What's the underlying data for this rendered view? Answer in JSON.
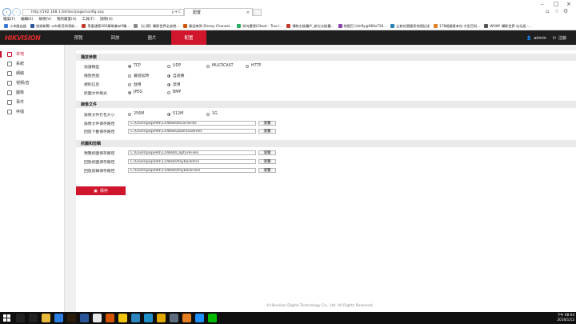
{
  "browser": {
    "url": "http://192.168.1.64/doc/page/config.asp",
    "addr_controls": "ρ ▾ C",
    "tab_title": "配置",
    "menu": [
      "檔案(F)",
      "編輯(E)",
      "檢視(V)",
      "我的最愛(A)",
      "工具(T)",
      "說明(H)"
    ],
    "favorites": [
      {
        "label": "小米路由器",
        "color": "#3b78d8"
      },
      {
        "label": "悠遊新聞 -udn影音與導航...",
        "color": "#2b579a"
      },
      {
        "label": "黑喜通第200萬幣業wifi電...",
        "color": "#c0392b"
      },
      {
        "label": "【心得】攝影世界全部就...",
        "color": "#888888"
      },
      {
        "label": "歡迎來到 Disney Channel...",
        "color": "#d35400"
      },
      {
        "label": "如何還原(Ghost - True l...",
        "color": "#27ae60"
      },
      {
        "label": "傳統水餃攤戶_新光水餃攤...",
        "color": "#c0392b"
      },
      {
        "label": "綠園百 [dinfly@960x720...",
        "color": "#8e44ad"
      },
      {
        "label": "立新花園國家地理記述",
        "color": "#2980b9"
      },
      {
        "label": "178遊戲資本包-大型百科...",
        "color": "#e67e22"
      },
      {
        "label": "WOW! 攝影世界 论坛组 -...",
        "color": "#555555"
      }
    ]
  },
  "app": {
    "logo": "HIKVISION",
    "tabs": [
      "預覽",
      "回放",
      "圖片",
      "配置"
    ],
    "active_tab": 3,
    "user": "admin",
    "logout": "注銷"
  },
  "sidebar": {
    "items": [
      "本地",
      "系統",
      "網絡",
      "視頻/音",
      "圖像",
      "事件",
      "存儲"
    ],
    "active": 0
  },
  "sections": {
    "playback_params": {
      "title": "播放參數",
      "rows": [
        {
          "label": "協議類型",
          "options": [
            "TCP",
            "UDP",
            "MULTICAST",
            "HTTP"
          ],
          "selected": 0
        },
        {
          "label": "播放性能",
          "options": [
            "最短延時",
            "自適應"
          ],
          "selected": 1
        },
        {
          "label": "規則信息",
          "options": [
            "啟用",
            "禁用"
          ],
          "selected": 1
        },
        {
          "label": "抓圖文件格式",
          "options": [
            "JPEG",
            "BMP"
          ],
          "selected": 0
        }
      ]
    },
    "record_files": {
      "title": "錄像文件",
      "size_row": {
        "label": "錄像文件打包大小",
        "options": [
          "256M",
          "512M",
          "1G"
        ],
        "selected": 1
      },
      "paths": [
        {
          "label": "錄像文件保存路徑",
          "value": "C:\\Users\\pope94\\11\\Web\\RecordFiles"
        },
        {
          "label": "回放下載保存路徑",
          "value": "C:\\Users\\pope94\\11\\Web\\DownloadFiles"
        }
      ]
    },
    "snapshot": {
      "title": "抓圖和剪輯",
      "paths": [
        {
          "label": "預覽抓圖保存路徑",
          "value": "C:\\Users\\pope94\\11\\Web\\CaptureFiles"
        },
        {
          "label": "回放抓圖保存路徑",
          "value": "C:\\Users\\pope94\\11\\Web\\PlaybackPics"
        },
        {
          "label": "回放剪輯保存路徑",
          "value": "C:\\Users\\pope94\\11\\Web\\PlaybackFiles"
        }
      ]
    },
    "browse_label": "瀏覽"
  },
  "save_label": "保存",
  "footer": "©Hikvision Digital Technology Co., Ltd. All Rights Reserved.",
  "taskbar": {
    "time": "下午 08:04",
    "date": "2016/1/12",
    "icons": [
      {
        "name": "search",
        "color": "#222222"
      },
      {
        "name": "task-view",
        "color": "#222222"
      },
      {
        "name": "explorer",
        "color": "#e8b93a"
      },
      {
        "name": "store",
        "color": "#2b7de1"
      },
      {
        "name": "illustrator",
        "color": "#2b1b0b"
      },
      {
        "name": "word",
        "color": "#2b579a"
      },
      {
        "name": "media-player",
        "color": "#e8e8e8"
      },
      {
        "name": "paint",
        "color": "#d35400"
      },
      {
        "name": "folder",
        "color": "#f1c40f"
      },
      {
        "name": "shield",
        "color": "#2e86c1"
      },
      {
        "name": "photos",
        "color": "#1e90c8"
      },
      {
        "name": "chrome",
        "color": "#e0a800"
      },
      {
        "name": "settings",
        "color": "#5d6d7e"
      },
      {
        "name": "firefox",
        "color": "#e67e22"
      },
      {
        "name": "internet-explorer",
        "color": "#1e90ff"
      },
      {
        "name": "line",
        "color": "#00b900"
      }
    ]
  }
}
